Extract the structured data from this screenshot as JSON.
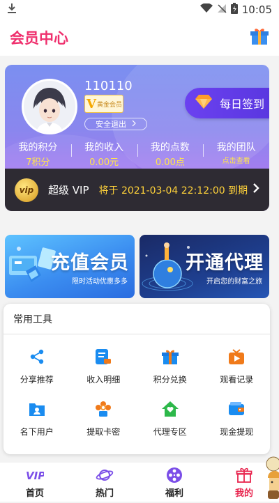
{
  "status_bar": {
    "time": "10:05"
  },
  "header": {
    "title": "会员中心"
  },
  "profile": {
    "username": "110110",
    "badge_letter": "V",
    "badge_text": "黄金会员",
    "logout_label": "安全退出",
    "checkin_label": "每日签到"
  },
  "stats": [
    {
      "label": "我的积分",
      "value": "7积分"
    },
    {
      "label": "我的收入",
      "value": "0.00元"
    },
    {
      "label": "我的点数",
      "value": "0.00点"
    },
    {
      "label": "我的团队",
      "value": "点击查看"
    }
  ],
  "vip": {
    "icon_text": "vip",
    "label": "超级 VIP",
    "expire_text": "将于 2021-03-04 22:12:00 到期"
  },
  "banners": [
    {
      "title": "充值会员",
      "subtitle": "限时活动优惠多多"
    },
    {
      "title": "开通代理",
      "subtitle": "开启您的财富之旅"
    }
  ],
  "tools": {
    "title": "常用工具",
    "items": [
      {
        "label": "分享推荐",
        "icon": "share-icon"
      },
      {
        "label": "收入明细",
        "icon": "income-detail-icon"
      },
      {
        "label": "积分兑换",
        "icon": "gift-icon"
      },
      {
        "label": "观看记录",
        "icon": "play-history-icon"
      },
      {
        "label": "名下用户",
        "icon": "user-folder-icon"
      },
      {
        "label": "提取卡密",
        "icon": "card-code-icon"
      },
      {
        "label": "代理专区",
        "icon": "agent-home-icon"
      },
      {
        "label": "现金提现",
        "icon": "wallet-icon"
      }
    ]
  },
  "nav": [
    {
      "label": "首页",
      "icon": "vip-home-icon"
    },
    {
      "label": "热门",
      "icon": "planet-icon"
    },
    {
      "label": "福利",
      "icon": "film-reel-icon"
    },
    {
      "label": "我的",
      "icon": "gift-profile-icon"
    }
  ],
  "colors": {
    "accent": "#ef2f6d",
    "gold": "#ffd23a",
    "tool_blue": "#1a8cf0",
    "tool_orange": "#f07a1a",
    "tool_green": "#2db84a"
  }
}
